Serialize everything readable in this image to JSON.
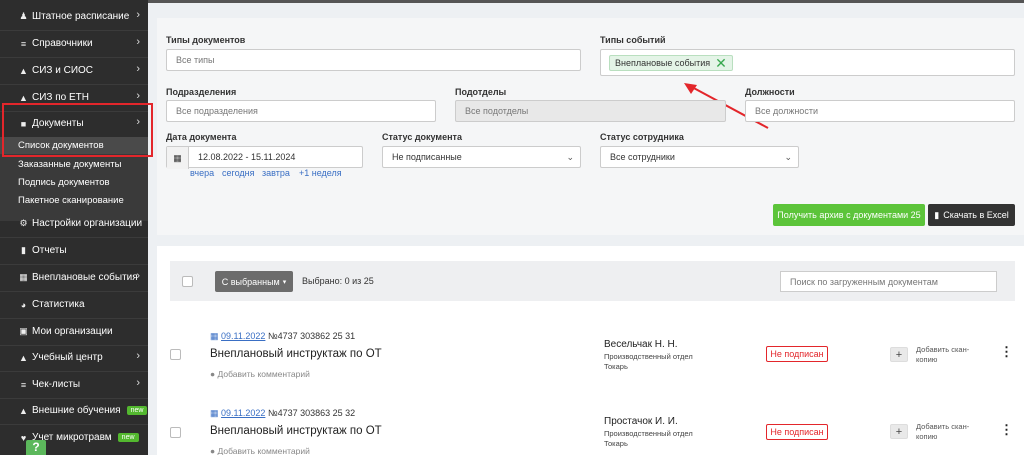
{
  "sidebar": {
    "items": [
      {
        "label": "Штатное расписание",
        "icon": "users-icon",
        "chevron": "›"
      },
      {
        "label": "Справочники",
        "icon": "list-icon",
        "chevron": "›"
      },
      {
        "label": "СИЗ и СИОС",
        "icon": "ppe-icon",
        "chevron": "›"
      },
      {
        "label": "СИЗ по ЕТН",
        "icon": "ppe-icon",
        "chevron": "›"
      },
      {
        "label": "Документы",
        "icon": "folder-icon",
        "chevron": "›"
      }
    ],
    "documents_submenu": [
      "Список документов",
      "Заказанные документы",
      "Подпись документов",
      "Пакетное сканирование"
    ],
    "items_after": [
      {
        "label": "Настройки организации",
        "icon": "gear-icon"
      },
      {
        "label": "Отчеты",
        "icon": "report-icon"
      },
      {
        "label": "Внеплановые события",
        "icon": "calendar-icon",
        "chevron": "›"
      },
      {
        "label": "Статистика",
        "icon": "pie-chart-icon"
      },
      {
        "label": "Мои организации",
        "icon": "briefcase-icon"
      },
      {
        "label": "Учебный центр",
        "icon": "graduation-cap-icon",
        "chevron": "›"
      },
      {
        "label": "Чек-листы",
        "icon": "checklist-icon",
        "chevron": "›"
      },
      {
        "label": "Внешние обучения",
        "icon": "graduation-cap-icon",
        "badge": "new"
      },
      {
        "label": "Учет микротравм",
        "icon": "heart-icon",
        "badge": "new"
      }
    ],
    "help_label": "?"
  },
  "filters": {
    "doc_types_label": "Типы документов",
    "doc_types_placeholder": "Все типы",
    "event_types_label": "Типы событий",
    "event_types_tag": "Внеплановые события",
    "event_types_tag_remove": "✕",
    "departments_label": "Подразделения",
    "departments_placeholder": "Все подразделения",
    "subdepartments_label": "Подотделы",
    "subdepartments_placeholder": "Все подотделы",
    "positions_label": "Должности",
    "positions_placeholder": "Все должности",
    "doc_date_label": "Дата документа",
    "doc_date_value": "12.08.2022 - 15.11.2024",
    "quick_dates": [
      "вчера",
      "сегодня",
      "завтра",
      "+1 неделя"
    ],
    "doc_status_label": "Статус документа",
    "doc_status_value": "Не подписанные",
    "employee_status_label": "Статус сотрудника",
    "employee_status_value": "Все сотрудники",
    "archive_button": "Получить архив с документами 25",
    "excel_button": "Скачать в Excel"
  },
  "list": {
    "with_selected_button": "С выбранным",
    "selected_count": "Выбрано: 0 из 25",
    "search_placeholder": "Поиск по загруженным документам",
    "rows": [
      {
        "date": "09.11.2022",
        "number": "№4737 303862 25 31",
        "title": "Внеплановый инструктаж по ОТ",
        "comment_link": "Добавить комментарий",
        "employee": "Весельчак Н. Н.",
        "department": "Производственный отдел",
        "position": "Токарь",
        "status": "Не подписан",
        "add_scan_line1": "Добавить скан-",
        "add_scan_line2": "копию"
      },
      {
        "date": "09.11.2022",
        "number": "№4737 303863 25 32",
        "title": "Внеплановый инструктаж по ОТ",
        "comment_link": "Добавить комментарий",
        "employee": "Простачок И. И.",
        "department": "Производственный отдел",
        "position": "Токарь",
        "status": "Не подписан",
        "add_scan_line1": "Добавить скан-",
        "add_scan_line2": "копию"
      }
    ]
  },
  "colors": {
    "sidebar_bg": "#2d2d2d",
    "highlight_red": "#e3262b",
    "green": "#5cc43a",
    "link_blue": "#3a6fc4"
  }
}
